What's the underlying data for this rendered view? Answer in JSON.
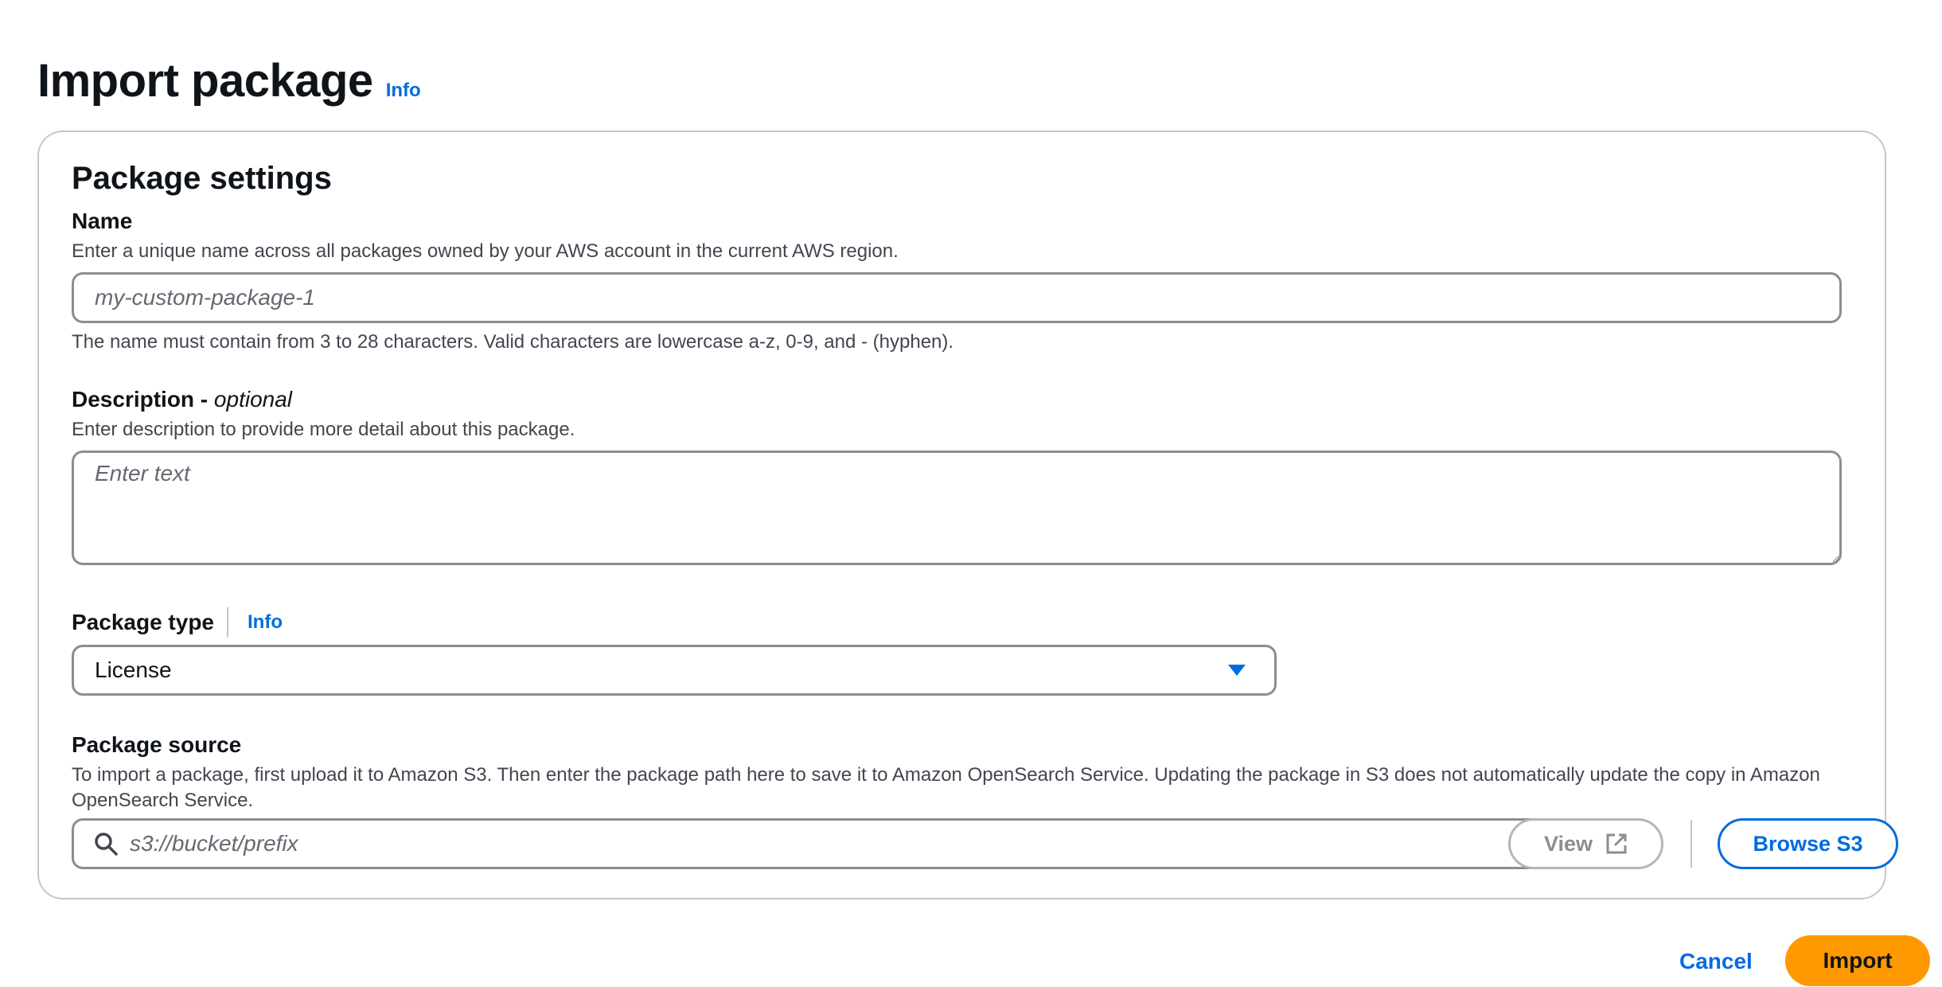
{
  "header": {
    "title": "Import package",
    "info_label": "Info"
  },
  "package_settings": {
    "title": "Package settings",
    "name": {
      "label": "Name",
      "description": "Enter a unique name across all packages owned by your AWS account in the current AWS region.",
      "placeholder": "my-custom-package-1",
      "value": "",
      "constraint": "The name must contain from 3 to 28 characters. Valid characters are lowercase a-z, 0-9, and - (hyphen)."
    },
    "description": {
      "label": "Description - ",
      "optional_label": "optional",
      "description": "Enter description to provide more detail about this package.",
      "placeholder": "Enter text",
      "value": ""
    },
    "package_type": {
      "label": "Package type",
      "info_label": "Info",
      "selected": "License"
    },
    "package_source": {
      "label": "Package source",
      "description": "To import a package, first upload it to Amazon S3. Then enter the package path here to save it to Amazon OpenSearch Service. Updating the package in S3 does not automatically update the copy in Amazon OpenSearch Service.",
      "placeholder": "s3://bucket/prefix",
      "value": "",
      "view_label": "View",
      "browse_label": "Browse S3"
    }
  },
  "footer": {
    "cancel_label": "Cancel",
    "import_label": "Import"
  },
  "colors": {
    "link": "#006ce0",
    "primary_button": "#ff9900",
    "border": "#8c8c94"
  }
}
